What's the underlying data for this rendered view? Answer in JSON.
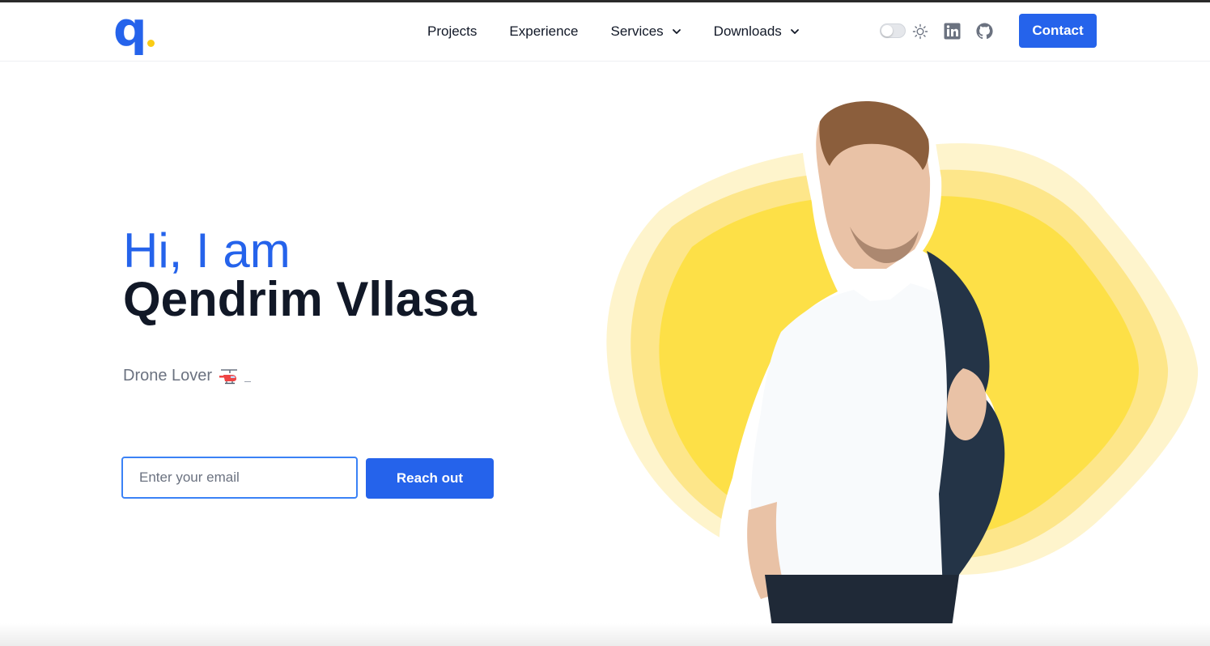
{
  "header": {
    "logo": {
      "letter": "q",
      "icon": "logo-q-icon"
    },
    "nav": [
      {
        "label": "Projects",
        "has_dropdown": false
      },
      {
        "label": "Experience",
        "has_dropdown": false
      },
      {
        "label": "Services",
        "has_dropdown": true
      },
      {
        "label": "Downloads",
        "has_dropdown": true
      }
    ],
    "theme_toggle": {
      "state": "off",
      "icon": "sun-icon"
    },
    "social": [
      {
        "name": "linkedin",
        "icon": "linkedin-icon"
      },
      {
        "name": "github",
        "icon": "github-icon"
      }
    ],
    "contact_label": "Contact"
  },
  "hero": {
    "greeting": "Hi, I am",
    "name": "Qendrim Vllasa",
    "tagline": "Drone Lover",
    "tagline_icon": "helicopter-icon",
    "email_placeholder": "Enter your email",
    "email_value": "",
    "cta_label": "Reach out"
  },
  "colors": {
    "primary": "#2563eb",
    "accent_yellow": "#facc15",
    "blob_yellow": "#fde047",
    "text_dark": "#111827",
    "text_muted": "#6b7280"
  }
}
